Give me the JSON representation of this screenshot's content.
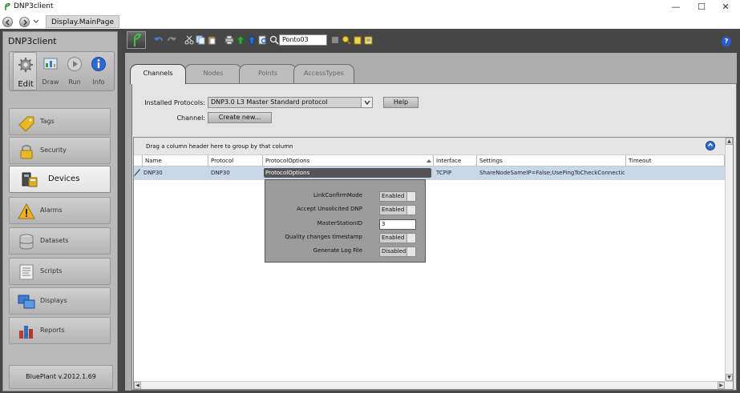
{
  "window": {
    "title": "DNP3client",
    "min": "—",
    "max": "☐",
    "close": "✕"
  },
  "nav": {
    "page": "Display.MainPage"
  },
  "sidebar": {
    "title": "DNP3client",
    "modes": [
      {
        "label": "Edit"
      },
      {
        "label": "Draw"
      },
      {
        "label": "Run"
      },
      {
        "label": "Info"
      }
    ],
    "items": [
      {
        "label": "Tags",
        "icon": "tag-icon"
      },
      {
        "label": "Security",
        "icon": "lock-icon"
      },
      {
        "label": "Devices",
        "icon": "devices-icon"
      },
      {
        "label": "Alarms",
        "icon": "alarm-icon"
      },
      {
        "label": "Datasets",
        "icon": "database-icon"
      },
      {
        "label": "Scripts",
        "icon": "script-icon"
      },
      {
        "label": "Displays",
        "icon": "display-icon"
      },
      {
        "label": "Reports",
        "icon": "report-icon"
      }
    ],
    "active_item": "Devices",
    "version": "BluePlant  v.2012.1.69"
  },
  "toolbar": {
    "search_value": "Ponto03",
    "help": "?"
  },
  "tabs": [
    {
      "label": "Channels"
    },
    {
      "label": "Nodes"
    },
    {
      "label": "Points"
    },
    {
      "label": "AccessTypes"
    }
  ],
  "channels": {
    "installed_label": "Installed Protocols:",
    "installed_value": "DNP3.0 L3 Master Standard protocol",
    "help_label": "Help",
    "channel_label": "Channel:",
    "create_label": "Create new..."
  },
  "grid": {
    "group_hint": "Drag a column header here to group by that column",
    "columns": [
      "Name",
      "Protocol",
      "ProtocolOptions",
      "Interface",
      "Settings",
      "Timeout"
    ],
    "row": {
      "name": "DNP30",
      "protocol": "DNP30",
      "options": "ProtocolOptions",
      "interface": "TCPIP",
      "settings": "ShareNodeSameIP=False;UsePingToCheckConnection..."
    }
  },
  "popup": {
    "rows": [
      {
        "label": "LinkConfirmMode",
        "value": "Enabled"
      },
      {
        "label": "Accept Unsolicited DNP",
        "value": "Enabled"
      },
      {
        "label": "MasterStationID",
        "value": "3"
      },
      {
        "label": "Quality changes timestamp",
        "value": "Enabled"
      },
      {
        "label": "Generate Log File",
        "value": "Disabled"
      }
    ]
  },
  "colors": {
    "frame": "#474747",
    "sidebar": "#b9b9b9",
    "content": "#adadad",
    "row_selected": "#c9d8e8",
    "accent": "#2b5cd6"
  }
}
